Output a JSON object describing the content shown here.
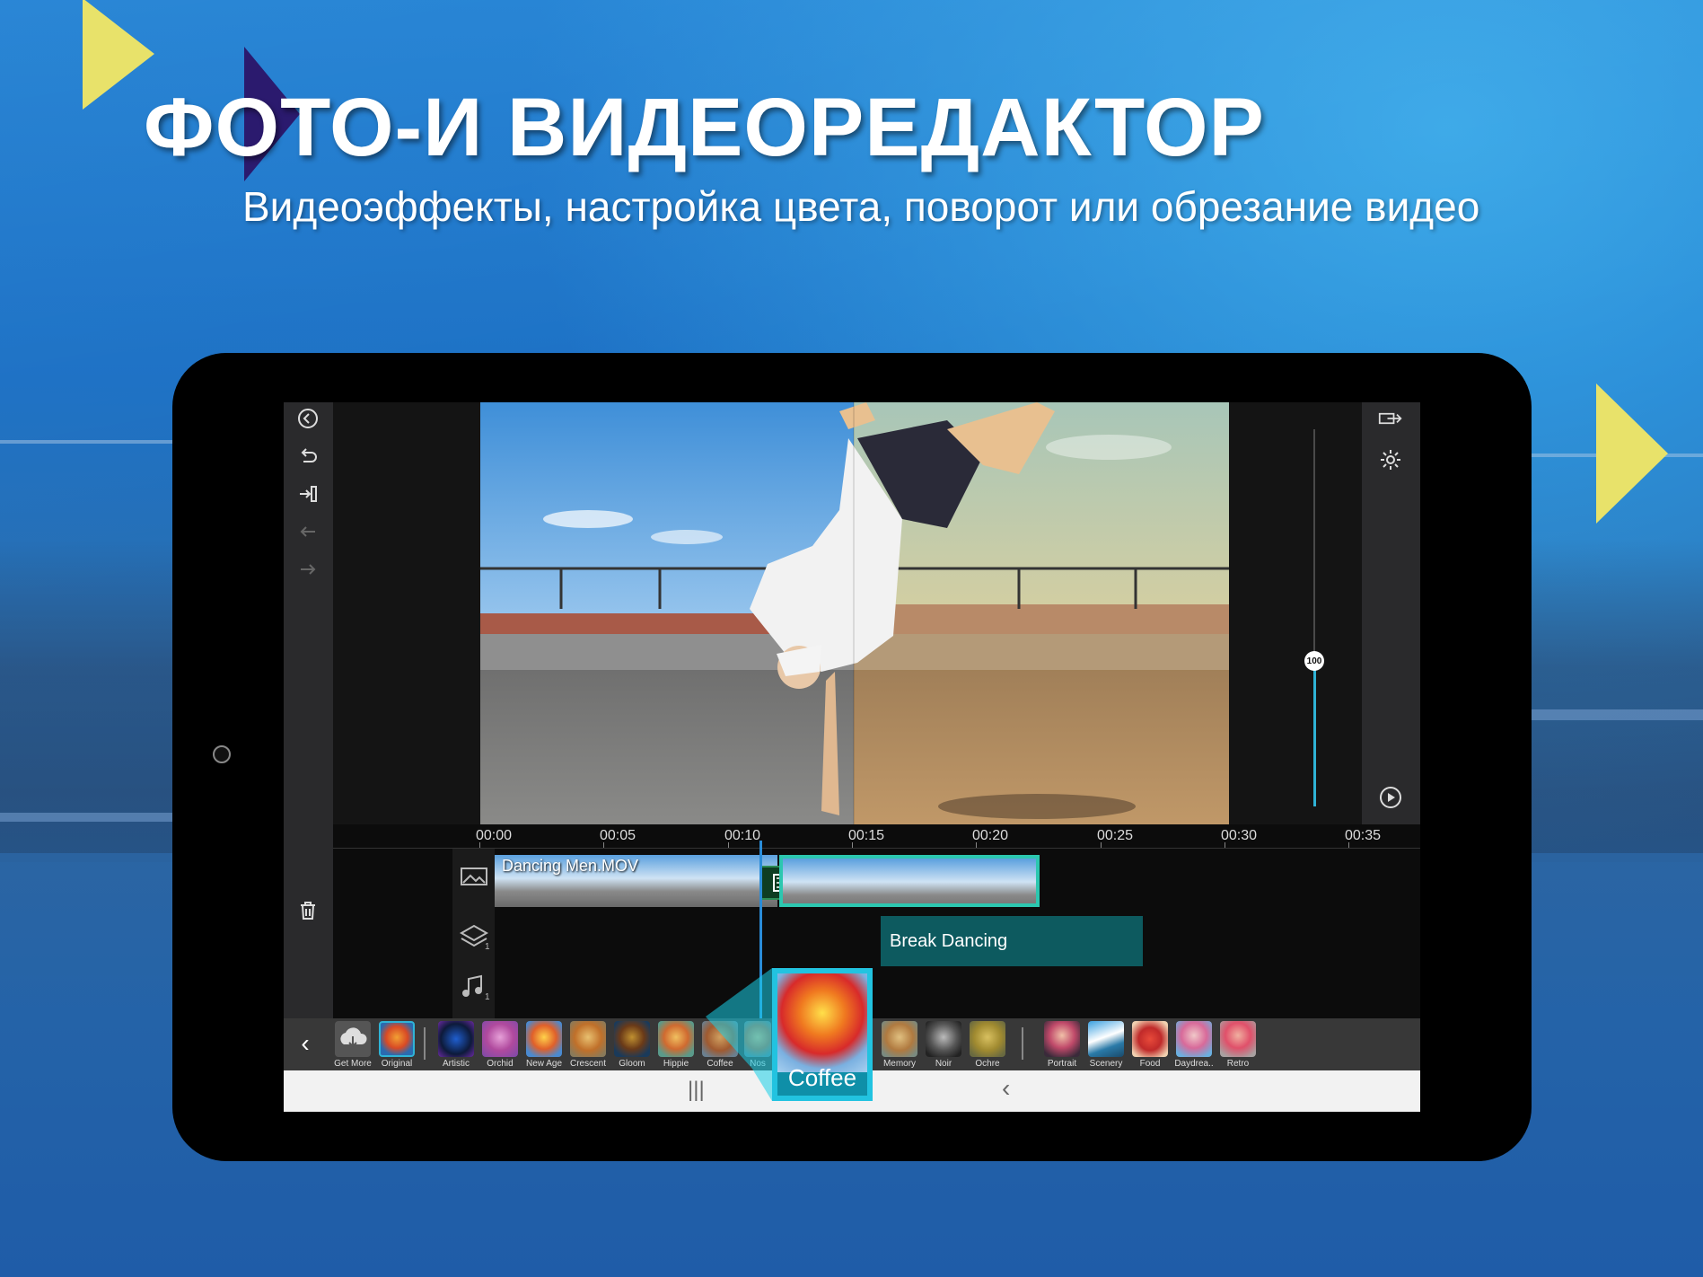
{
  "promo": {
    "title": "ФОТО-И ВИДЕОРЕДАКТОР",
    "subtitle": "Видеоэффекты, настройка цвета, поворот или обрезание видео"
  },
  "colors": {
    "accent": "#2fb3d6",
    "clip_border": "#2cc7b0",
    "text_clip": "#0d5a5f",
    "yellow_triangle": "#e8e26a",
    "purple_triangle": "#2b1a6e"
  },
  "editor": {
    "left_toolbar": [
      {
        "icon": "back-circle-icon"
      },
      {
        "icon": "undo-icon"
      },
      {
        "icon": "import-icon"
      },
      {
        "icon": "arrow-left-icon"
      },
      {
        "icon": "arrow-right-icon"
      },
      {
        "icon": "trash-icon"
      }
    ],
    "right_toolbar": [
      {
        "icon": "export-icon"
      },
      {
        "icon": "settings-icon"
      },
      {
        "icon": "play-icon"
      }
    ],
    "slider_value": "100",
    "timeline": {
      "ticks": [
        "00:00",
        "00:05",
        "00:10",
        "00:15",
        "00:20",
        "00:25",
        "00:30",
        "00:35"
      ],
      "video_clip_label": "Dancing Men.MOV",
      "text_clip_label": "Break Dancing",
      "overlay_track_count": "1",
      "audio_track_count": "1"
    },
    "effects": [
      {
        "label": "Get More",
        "icon": "cloud-download-icon"
      },
      {
        "label": "Original"
      },
      {
        "label": "Artistic"
      },
      {
        "label": "Orchid"
      },
      {
        "label": "New Age"
      },
      {
        "label": "Crescent"
      },
      {
        "label": "Gloom"
      },
      {
        "label": "Hippie"
      },
      {
        "label": "Coffee"
      },
      {
        "label": "Nos"
      },
      {
        "label": "Memory"
      },
      {
        "label": "Noir"
      },
      {
        "label": "Ochre"
      },
      {
        "label": "Portrait"
      },
      {
        "label": "Scenery"
      },
      {
        "label": "Food"
      },
      {
        "label": "Daydrea.."
      },
      {
        "label": "Retro"
      }
    ],
    "selected_effect": "Coffee",
    "navbar": {
      "recents": "|||",
      "back": "‹"
    }
  }
}
